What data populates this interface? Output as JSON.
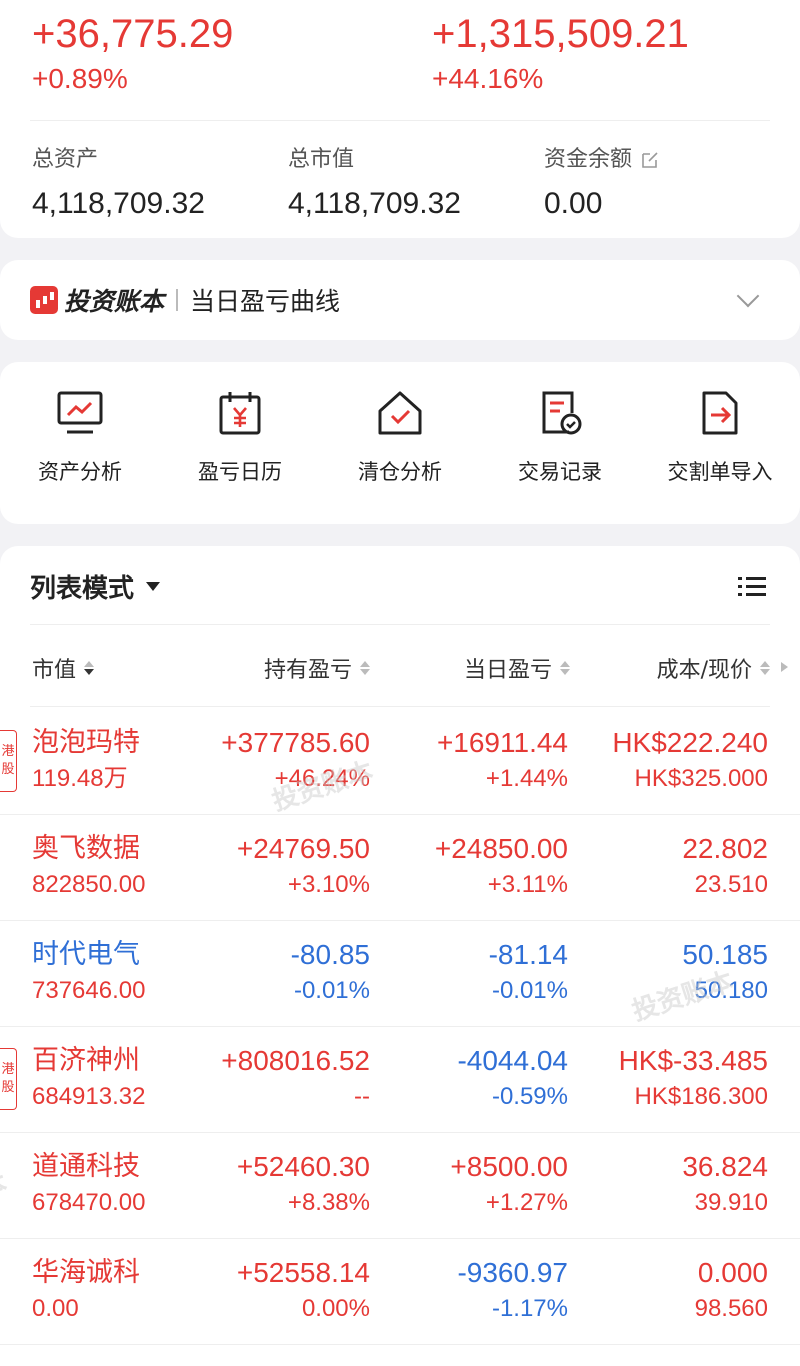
{
  "summary": {
    "daily_pnl": "+36,775.29",
    "daily_pct": "+0.89%",
    "hold_pnl": "+1,315,509.21",
    "hold_pct": "+44.16%",
    "total_assets_label": "总资产",
    "total_assets": "4,118,709.32",
    "market_value_label": "总市值",
    "market_value": "4,118,709.32",
    "cash_label": "资金余额",
    "cash": "0.00"
  },
  "curve": {
    "brand": "投资账本",
    "title": "当日盈亏曲线"
  },
  "tools": [
    {
      "label": "资产分析",
      "icon": "chart-monitor-icon"
    },
    {
      "label": "盈亏日历",
      "icon": "calendar-yen-icon"
    },
    {
      "label": "清仓分析",
      "icon": "house-check-icon"
    },
    {
      "label": "交易记录",
      "icon": "document-check-icon"
    },
    {
      "label": "交割单导入",
      "icon": "import-file-icon"
    }
  ],
  "list": {
    "mode_label": "列表模式",
    "headers": [
      "市值",
      "持有盈亏",
      "当日盈亏",
      "成本/现价"
    ]
  },
  "rows": [
    {
      "badge": "港股",
      "name": "泡泡玛特",
      "value": "119.48万",
      "hold": "+377785.60",
      "hold_pct": "+46.24%",
      "day": "+16911.44",
      "day_pct": "+1.44%",
      "cost": "HK$222.240",
      "price": "HK$325.000",
      "hold_color": "red",
      "day_color": "red",
      "name_color": "red",
      "cost_color": "red"
    },
    {
      "badge": "",
      "name": "奥飞数据",
      "value": "822850.00",
      "hold": "+24769.50",
      "hold_pct": "+3.10%",
      "day": "+24850.00",
      "day_pct": "+3.11%",
      "cost": "22.802",
      "price": "23.510",
      "hold_color": "red",
      "day_color": "red",
      "name_color": "red",
      "cost_color": "red"
    },
    {
      "badge": "",
      "name": "时代电气",
      "value": "737646.00",
      "hold": "-80.85",
      "hold_pct": "-0.01%",
      "day": "-81.14",
      "day_pct": "-0.01%",
      "cost": "50.185",
      "price": "50.180",
      "hold_color": "blue",
      "day_color": "blue",
      "name_color": "blue",
      "cost_color": "blue"
    },
    {
      "badge": "港股",
      "name": "百济神州",
      "value": "684913.32",
      "hold": "+808016.52",
      "hold_pct": "--",
      "day": "-4044.04",
      "day_pct": "-0.59%",
      "cost": "HK$-33.485",
      "price": "HK$186.300",
      "hold_color": "red",
      "day_color": "blue",
      "name_color": "red",
      "cost_color": "red"
    },
    {
      "badge": "",
      "name": "道通科技",
      "value": "678470.00",
      "hold": "+52460.30",
      "hold_pct": "+8.38%",
      "day": "+8500.00",
      "day_pct": "+1.27%",
      "cost": "36.824",
      "price": "39.910",
      "hold_color": "red",
      "day_color": "red",
      "name_color": "red",
      "cost_color": "red"
    },
    {
      "badge": "",
      "name": "华海诚科",
      "value": "0.00",
      "hold": "+52558.14",
      "hold_pct": "0.00%",
      "day": "-9360.97",
      "day_pct": "-1.17%",
      "cost": "0.000",
      "price": "98.560",
      "hold_color": "red",
      "day_color": "blue",
      "name_color": "red",
      "cost_color": "red"
    }
  ],
  "colors": {
    "red": "#e53935",
    "blue": "#2f6fd6"
  }
}
